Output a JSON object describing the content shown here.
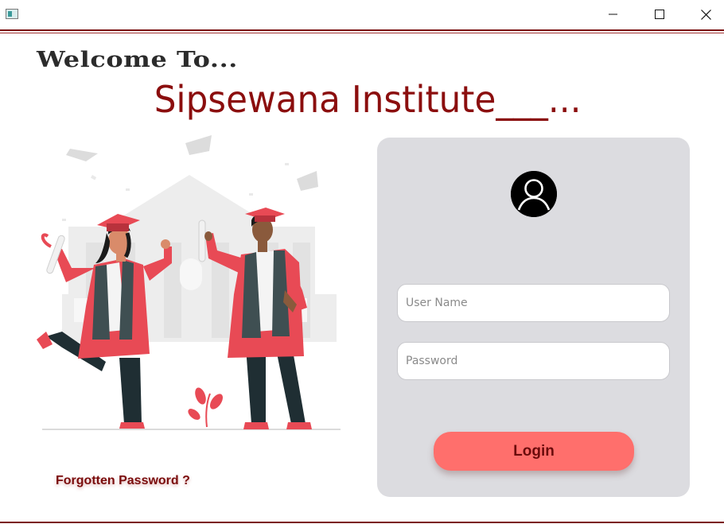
{
  "window": {
    "icons": {
      "app": "app-window-icon",
      "minimize": "minimize-icon",
      "maximize": "maximize-icon",
      "close": "close-icon"
    }
  },
  "header": {
    "welcome": "Welcome To...",
    "institute": "Sipsewana Institute___..."
  },
  "illustration": {
    "icon": "graduates-illustration"
  },
  "login_panel": {
    "avatar_icon": "user-avatar-icon",
    "username_placeholder": "User Name",
    "username_value": "",
    "password_placeholder": "Password",
    "password_value": "",
    "login_label": "Login"
  },
  "footer": {
    "forgot_label": "Forgotten Password ?"
  },
  "colors": {
    "brand": "#8b0e0e",
    "panel": "#dcdce0",
    "login_button": "#ff6f6c",
    "accent_red": "#e84a55"
  }
}
